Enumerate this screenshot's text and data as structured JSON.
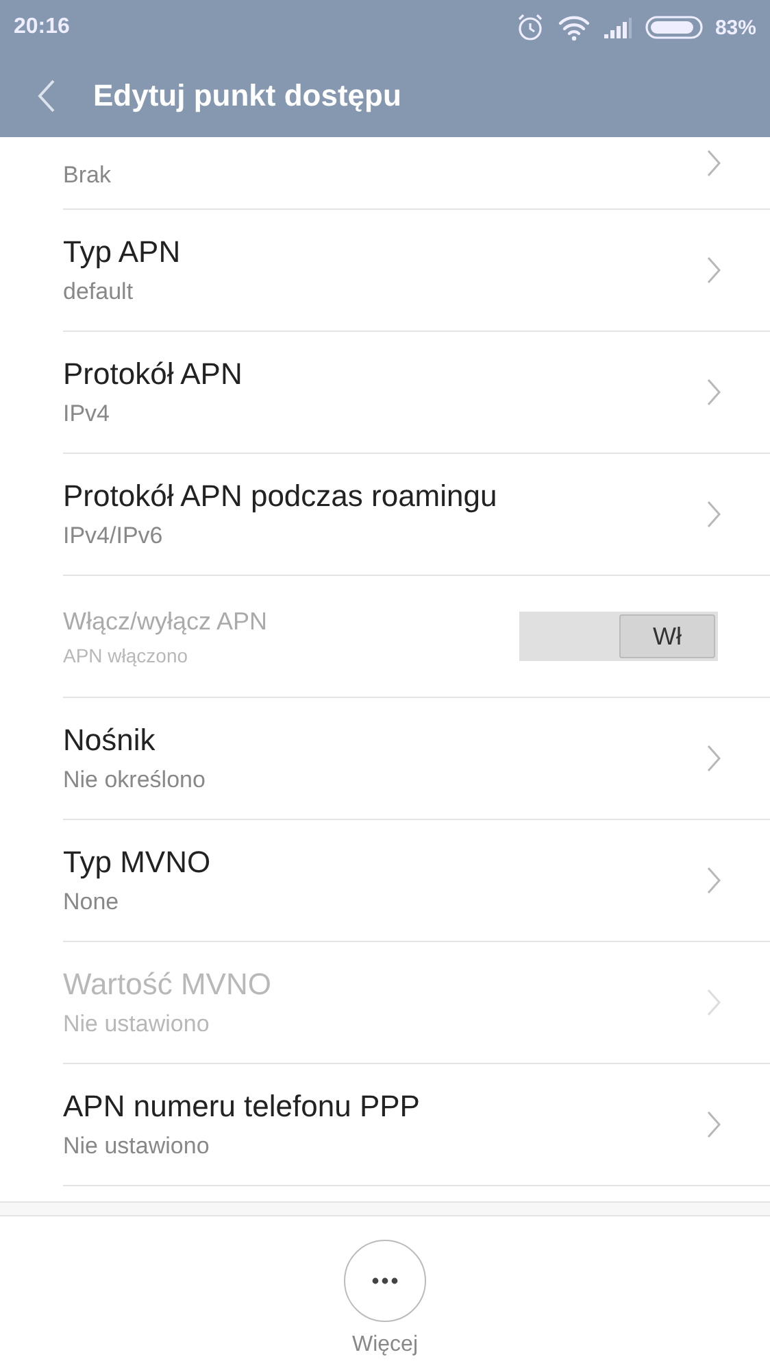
{
  "status_bar": {
    "time": "20:16",
    "battery": "83%"
  },
  "app_bar": {
    "title": "Edytuj punkt dostępu"
  },
  "items": [
    {
      "kind": "nav",
      "subtitle": "Brak",
      "disabled": false
    },
    {
      "kind": "nav",
      "title": "Typ APN",
      "subtitle": "default",
      "disabled": false
    },
    {
      "kind": "nav",
      "title": "Protokół APN",
      "subtitle": "IPv4",
      "disabled": false
    },
    {
      "kind": "nav",
      "title": "Protokół APN podczas roamingu",
      "subtitle": "IPv4/IPv6",
      "disabled": false
    },
    {
      "kind": "toggle",
      "title": "Włącz/wyłącz APN",
      "subtitle": "APN włączono",
      "disabled": true,
      "on": true,
      "switch_label": "Wł"
    },
    {
      "kind": "nav",
      "title": "Nośnik",
      "subtitle": "Nie określono",
      "disabled": false
    },
    {
      "kind": "nav",
      "title": "Typ MVNO",
      "subtitle": "None",
      "disabled": false
    },
    {
      "kind": "nav",
      "title": "Wartość MVNO",
      "subtitle": "Nie ustawiono",
      "disabled": true
    },
    {
      "kind": "nav",
      "title": "APN numeru telefonu PPP",
      "subtitle": "Nie ustawiono",
      "disabled": false
    }
  ],
  "bottom_bar": {
    "more_label": "Więcej"
  }
}
